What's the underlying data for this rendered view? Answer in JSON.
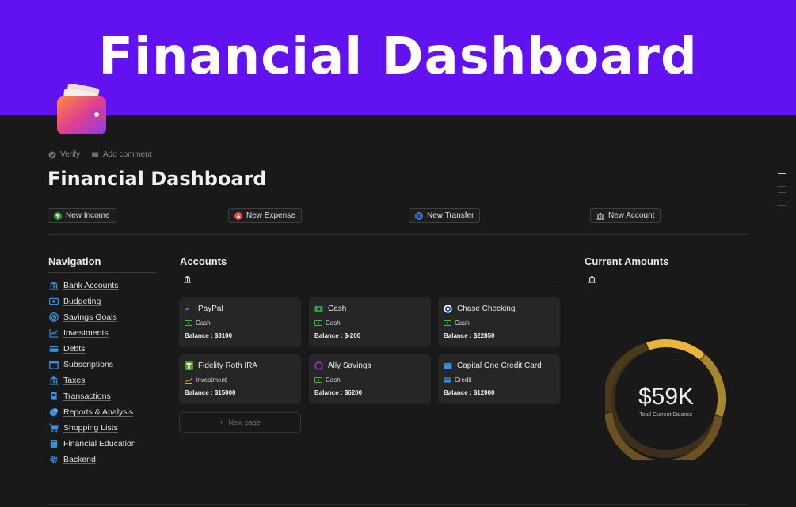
{
  "banner": {
    "title": "Financial Dashboard"
  },
  "meta": {
    "verify": "Verify",
    "add_comment": "Add comment"
  },
  "page": {
    "title": "Financial Dashboard"
  },
  "actions": [
    {
      "label": "New Income",
      "icon": "arrow-up-circle-icon",
      "color": "#2ea043"
    },
    {
      "label": "New Expense",
      "icon": "arrow-down-circle-icon",
      "color": "#e5484d"
    },
    {
      "label": "New Transfer",
      "icon": "globe-icon",
      "color": "#3b82f6"
    },
    {
      "label": "New Account",
      "icon": "bank-icon",
      "color": "#e0e0e0"
    }
  ],
  "navigation": {
    "title": "Navigation",
    "items": [
      {
        "label": "Bank Accounts",
        "icon": "bank-icon"
      },
      {
        "label": "Budgeting",
        "icon": "money-icon"
      },
      {
        "label": "Savings Goals",
        "icon": "target-icon"
      },
      {
        "label": "Investments",
        "icon": "chart-line-icon"
      },
      {
        "label": "Debts",
        "icon": "credit-card-icon"
      },
      {
        "label": "Subscriptions",
        "icon": "calendar-icon"
      },
      {
        "label": "Taxes",
        "icon": "government-icon"
      },
      {
        "label": "Transactions",
        "icon": "receipt-icon"
      },
      {
        "label": "Reports & Analysis",
        "icon": "pie-chart-icon"
      },
      {
        "label": "Shopping Lists",
        "icon": "cart-icon"
      },
      {
        "label": "Financial Education",
        "icon": "book-icon"
      },
      {
        "label": "Backend",
        "icon": "gear-icon"
      }
    ]
  },
  "accounts": {
    "title": "Accounts",
    "new_page": "New page",
    "cards": [
      {
        "name": "PayPal",
        "icon": "paypal-icon",
        "type": "Cash",
        "balance": "Balance : $3100"
      },
      {
        "name": "Cash",
        "icon": "cash-icon",
        "type": "Cash",
        "balance": "Balance : $-200"
      },
      {
        "name": "Chase Checking",
        "icon": "chase-icon",
        "type": "Cash",
        "balance": "Balance : $22850"
      },
      {
        "name": "Fidelity Roth IRA",
        "icon": "fidelity-icon",
        "type": "Investment",
        "balance": "Balance : $15000"
      },
      {
        "name": "Ally Savings",
        "icon": "ally-icon",
        "type": "Cash",
        "balance": "Balance : $6200"
      },
      {
        "name": "Capital One Credit Card",
        "icon": "credit-card-icon",
        "type": "Credit",
        "balance": "Balance : $12000"
      }
    ]
  },
  "current": {
    "title": "Current Amounts",
    "amount": "$59K",
    "caption": "Total Current Balance",
    "ring_color": "#e8b63a"
  }
}
